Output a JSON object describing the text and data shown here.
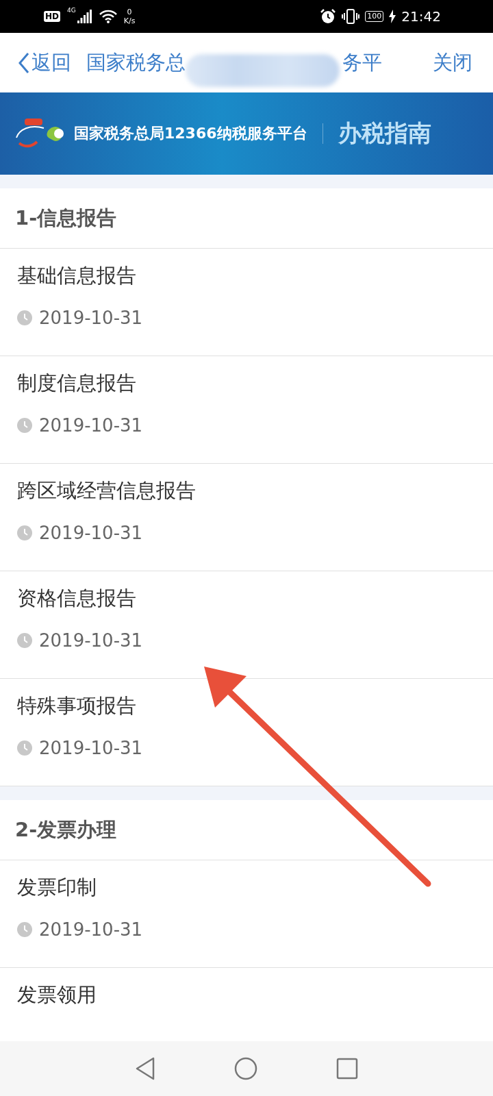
{
  "status_bar": {
    "network_badge": "HD",
    "network_type": "4G",
    "speed_value": "0",
    "speed_unit": "K/s",
    "battery": "100",
    "time": "21:42"
  },
  "nav_bar": {
    "back": "返回",
    "title_start": "国家税务总",
    "title_end": "务平",
    "close": "关闭"
  },
  "banner": {
    "platform": "国家税务总局12366纳税服务平台",
    "section": "办税指南"
  },
  "sections": [
    {
      "title": "1-信息报告",
      "items": [
        {
          "title": "基础信息报告",
          "date": "2019-10-31"
        },
        {
          "title": "制度信息报告",
          "date": "2019-10-31"
        },
        {
          "title": "跨区域经营信息报告",
          "date": "2019-10-31"
        },
        {
          "title": "资格信息报告",
          "date": "2019-10-31"
        },
        {
          "title": "特殊事项报告",
          "date": "2019-10-31"
        }
      ]
    },
    {
      "title": "2-发票办理",
      "items": [
        {
          "title": "发票印制",
          "date": "2019-10-31"
        },
        {
          "title": "发票领用"
        }
      ]
    }
  ]
}
